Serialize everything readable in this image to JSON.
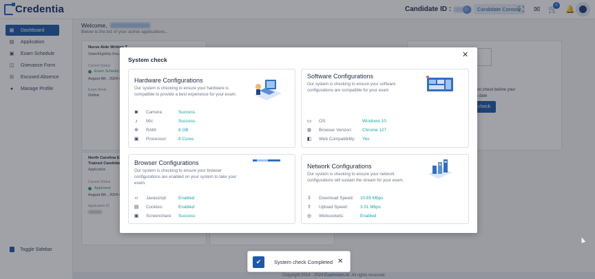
{
  "header": {
    "logo": "Credentia",
    "candidate_id_label": "Candidate ID :",
    "candidate_console_label": "Candidate Console",
    "notification_count": "0"
  },
  "sidebar": {
    "items": [
      {
        "label": "Dashboard",
        "icon": "grid-icon",
        "active": true
      },
      {
        "label": "Application",
        "icon": "document-icon"
      },
      {
        "label": "Exam Schedule",
        "icon": "calendar-icon"
      },
      {
        "label": "Grievance Form",
        "icon": "form-icon"
      },
      {
        "label": "Excused Absence",
        "icon": "absence-icon"
      },
      {
        "label": "Manage Profile",
        "icon": "person-icon"
      }
    ],
    "toggle_label": "Toggle Sidebar"
  },
  "main": {
    "welcome_label": "Welcome,",
    "welcome_sub": "Below is the list of your active applications...",
    "cards": [
      {
        "title": "Nurse Aide Written T...",
        "subtitle": "State/Eligibility Rou...",
        "status_label": "Current Status",
        "status_value": "Exam Schedul...",
        "date_value": "August 8th , 2024 /",
        "mode_label": "Exam Mode",
        "mode_value": "Online"
      },
      {
        "title_line1": "North Carolina E1",
        "title_line2": "Trained Candidate",
        "subtitle": "Application",
        "status_label": "Current Status",
        "status_value": "Approved",
        "date_value": "August 8th , 2024 /",
        "id_label": "Application ID"
      }
    ],
    "right_card": {
      "text_line1": "tem check before your",
      "text_line2": "m date",
      "button_label": "check"
    }
  },
  "modal": {
    "title": "System check",
    "panels": [
      {
        "title": "Hardware Configurations",
        "description": "Our system is checking to ensure your hardware is compatible to provide a best experience for your exam.",
        "rows": [
          {
            "icon": "camera-icon",
            "label": "Camera:",
            "value": "Success"
          },
          {
            "icon": "mic-icon",
            "label": "Mic:",
            "value": "Success"
          },
          {
            "icon": "ram-icon",
            "label": "RAM:",
            "value": "8 GB"
          },
          {
            "icon": "processor-icon",
            "label": "Processor:",
            "value": "8 Cores"
          }
        ]
      },
      {
        "title": "Software Configurations",
        "description": "Our system is checking to ensure your software configurations are compatible for your exam",
        "rows": [
          {
            "icon": "monitor-icon",
            "label": "OS:",
            "value": "Windows 10"
          },
          {
            "icon": "globe-icon",
            "label": "Browser Version:",
            "value": "Chrome 127"
          },
          {
            "icon": "web-icon",
            "label": "Web Compatibility:",
            "value": "Yes"
          }
        ]
      },
      {
        "title": "Browser Configurations",
        "description": "Our system is checking to ensure your browser configurations are enabled on your system to take your exam.",
        "rows": [
          {
            "icon": "code-icon",
            "label": "Javascript:",
            "value": "Enabled"
          },
          {
            "icon": "cookie-icon",
            "label": "Cookies:",
            "value": "Enabled"
          },
          {
            "icon": "screenshare-icon",
            "label": "Screenshare:",
            "value": "Success"
          }
        ]
      },
      {
        "title": "Network Configurations",
        "description": "Our system is checking to ensure your network configurations will sustain the stream for your exam.",
        "rows": [
          {
            "icon": "download-icon",
            "label": "Download Speed:",
            "value": "10.85 Mbps"
          },
          {
            "icon": "upload-icon",
            "label": "Upload Speed:",
            "value": "3.51 Mbps"
          },
          {
            "icon": "websocket-icon",
            "label": "Websockets:",
            "value": "Enabled"
          }
        ]
      }
    ]
  },
  "toast": {
    "message": "System check Completed"
  },
  "footer": {
    "text_before": "Copyright 2014 - 2024",
    "link": "Examroom.AI",
    "text_after": ". All rights reserved."
  },
  "colors": {
    "primary": "#1d5aa8",
    "success": "#1aa6a0",
    "status_green": "#1ea672"
  }
}
